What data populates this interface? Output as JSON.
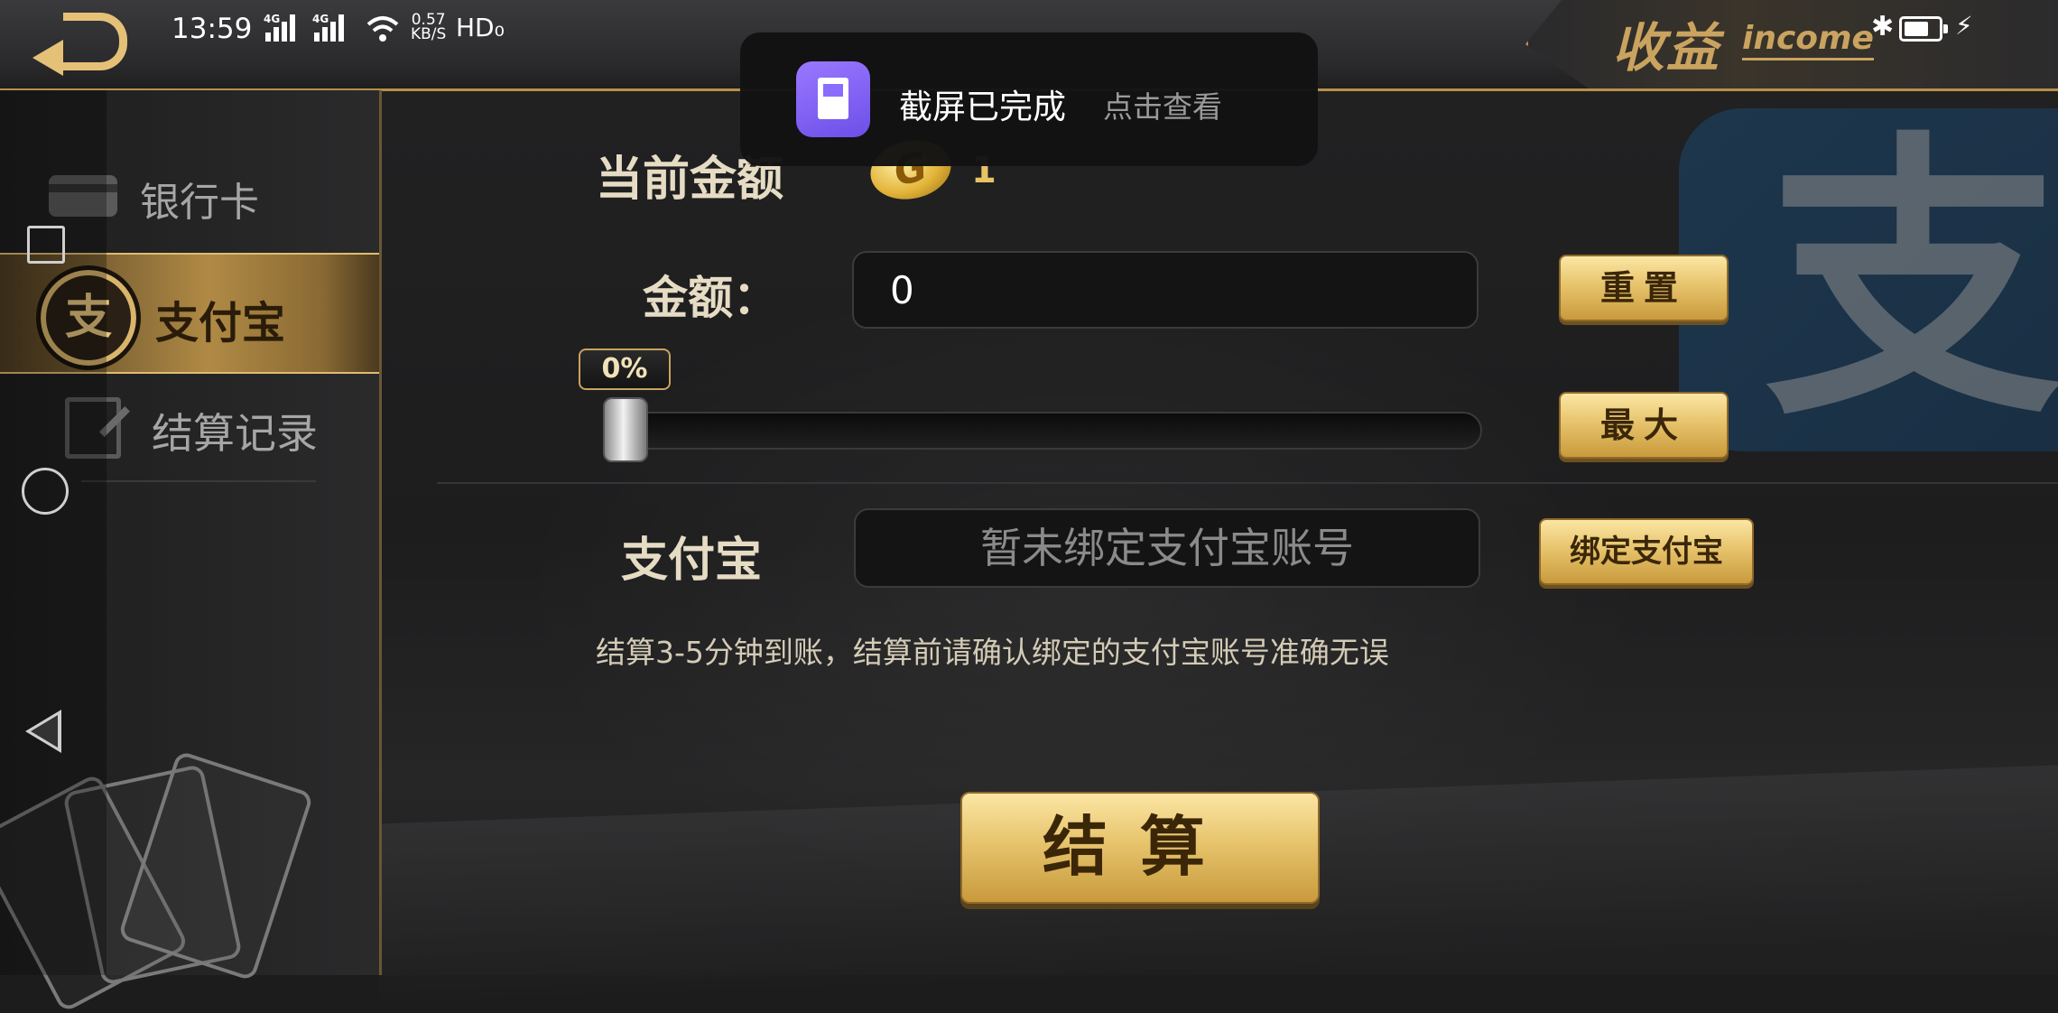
{
  "status_bar": {
    "time": "13:59",
    "network_1": "4G",
    "network_2": "4G",
    "speed_value": "0.57",
    "speed_unit": "KB/S",
    "hd": "HD₀"
  },
  "header": {
    "title": "收益",
    "title_sub": "income"
  },
  "toast": {
    "title": "截屏已完成",
    "action": "点击查看"
  },
  "sidebar": {
    "items": [
      {
        "label": "银行卡",
        "icon": "bank-card-icon",
        "selected": false
      },
      {
        "label": "支付宝",
        "icon": "alipay-icon",
        "icon_glyph": "支",
        "selected": true
      },
      {
        "label": "结算记录",
        "icon": "record-icon",
        "selected": false
      }
    ]
  },
  "balance": {
    "label": "当前金额",
    "coin_glyph": "G",
    "value": "1"
  },
  "amount": {
    "label": "金额：",
    "value": "0",
    "reset_label": "重置",
    "max_label": "最大",
    "percent_text": "0%",
    "slider_fraction": 0
  },
  "alipay": {
    "label": "支付宝",
    "account_placeholder": "暂未绑定支付宝账号",
    "bind_label": "绑定支付宝"
  },
  "notice": "结算3-5分钟到账，结算前请确认绑定的支付宝账号准确无误",
  "settle_label": "结算",
  "watermark_glyph": "支",
  "colors": {
    "gold": "#e7c46d",
    "accent_text": "#e6dcc4",
    "toast_bg": "#121212"
  }
}
